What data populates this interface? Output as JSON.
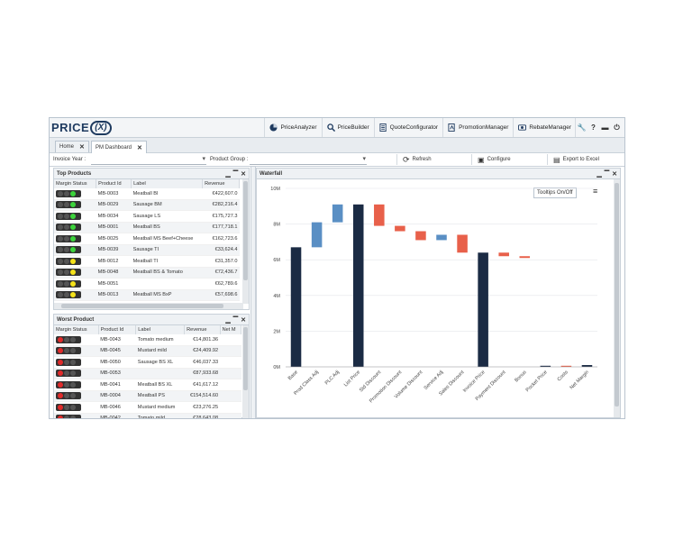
{
  "logo": {
    "text": "PRICE",
    "fx": "(X)"
  },
  "modules": [
    {
      "label": "PriceAnalyzer",
      "icon": "pie-chart-icon",
      "color": "#1e3a5f"
    },
    {
      "label": "PriceBuilder",
      "icon": "search-price-icon",
      "color": "#1e3a5f"
    },
    {
      "label": "QuoteConfigurator",
      "icon": "quote-document-icon",
      "color": "#1e3a5f"
    },
    {
      "label": "PromotionManager",
      "icon": "promotion-document-icon",
      "color": "#1e3a5f"
    },
    {
      "label": "RebateManager",
      "icon": "rebate-icon",
      "color": "#1e3a5f"
    }
  ],
  "tools": [
    "wrench-icon",
    "help-icon",
    "card-icon",
    "logout-icon"
  ],
  "tabs": [
    {
      "label": "Home"
    },
    {
      "label": "PM Dashboard"
    }
  ],
  "filters": {
    "invoice_year": "Invoice Year",
    "product_group": "Product Group",
    "refresh": "Refresh",
    "configure": "Configure",
    "export": "Export to Excel"
  },
  "top_products": {
    "title": "Top Products",
    "columns": [
      "Margin Status",
      "Product Id",
      "Label",
      "Revenue"
    ],
    "rows": [
      {
        "status": "green",
        "id": "MB-0003",
        "label": "Meatball BI",
        "revenue": "€422,607.0"
      },
      {
        "status": "green",
        "id": "MB-0029",
        "label": "Sausage BM",
        "revenue": "€282,216.4"
      },
      {
        "status": "green",
        "id": "MB-0034",
        "label": "Sausage LS",
        "revenue": "€175,727.3"
      },
      {
        "status": "green",
        "id": "MB-0001",
        "label": "Meatball BS",
        "revenue": "€177,718.1"
      },
      {
        "status": "green",
        "id": "MB-0025",
        "label": "Meatball MS Beef+Cheese",
        "revenue": "€162,723.6"
      },
      {
        "status": "green",
        "id": "MB-0039",
        "label": "Sausage TI",
        "revenue": "€33,624.4"
      },
      {
        "status": "yellow",
        "id": "MB-0012",
        "label": "Meatball TI",
        "revenue": "€31,357.0"
      },
      {
        "status": "yellow",
        "id": "MB-0048",
        "label": "Meatball BS & Tomato",
        "revenue": "€72,436.7"
      },
      {
        "status": "yellow",
        "id": "MB-0051",
        "label": "",
        "revenue": "€62,789.6"
      },
      {
        "status": "yellow",
        "id": "MB-0013",
        "label": "Meatball MS BxP",
        "revenue": "€57,698.6"
      },
      {
        "status": "yellow",
        "id": "MB-0021",
        "label": "Sausage BS",
        "revenue": "€178,159.2"
      }
    ]
  },
  "worst_products": {
    "title": "Worst Product",
    "columns": [
      "Margin Status",
      "Product Id",
      "Label",
      "Revenue",
      "Net M"
    ],
    "rows": [
      {
        "status": "red",
        "id": "MB-0043",
        "label": "Tomato medium",
        "revenue": "€14,801.36"
      },
      {
        "status": "red",
        "id": "MB-0045",
        "label": "Mustard mild",
        "revenue": "€24,409.92"
      },
      {
        "status": "red",
        "id": "MB-0050",
        "label": "Sausage BS XL",
        "revenue": "€46,037.33"
      },
      {
        "status": "red",
        "id": "MB-0053",
        "label": "",
        "revenue": "€87,933.68"
      },
      {
        "status": "red",
        "id": "MB-0041",
        "label": "Meatball BS XL",
        "revenue": "€41,617.12"
      },
      {
        "status": "red",
        "id": "MB-0004",
        "label": "Meatball PS",
        "revenue": "€154,514.60"
      },
      {
        "status": "red",
        "id": "MB-0046",
        "label": "Mustard medium",
        "revenue": "€23,276.25"
      },
      {
        "status": "red",
        "id": "MB-0042",
        "label": "Tomato mild",
        "revenue": "€28,643.08"
      }
    ]
  },
  "waterfall": {
    "title": "Waterfall",
    "tooltips_label": "Tooltips On/Off"
  },
  "chart_data": {
    "type": "bar",
    "title": "",
    "ylim": [
      0,
      10
    ],
    "yticks": [
      "0M",
      "2M",
      "4M",
      "6M",
      "8M",
      "10M"
    ],
    "grid": true,
    "categories": [
      "Base",
      "Prod Class Adj",
      "PLC Adj",
      "List Price",
      "Std Discount",
      "Promotion Discount",
      "Volume Discount",
      "Service Adj",
      "Sales Discount",
      "Invoice Price",
      "Payment Discount",
      "Bonus",
      "Pocket Price",
      "Costs",
      "Net Margin"
    ],
    "bars": [
      {
        "start": 0,
        "end": 6.7,
        "kind": "total"
      },
      {
        "start": 6.7,
        "end": 8.1,
        "kind": "increase"
      },
      {
        "start": 8.1,
        "end": 9.1,
        "kind": "increase"
      },
      {
        "start": 0,
        "end": 9.1,
        "kind": "total"
      },
      {
        "start": 9.1,
        "end": 7.9,
        "kind": "decrease"
      },
      {
        "start": 7.9,
        "end": 7.6,
        "kind": "decrease"
      },
      {
        "start": 7.6,
        "end": 7.1,
        "kind": "decrease"
      },
      {
        "start": 7.1,
        "end": 7.4,
        "kind": "increase"
      },
      {
        "start": 7.4,
        "end": 6.4,
        "kind": "decrease"
      },
      {
        "start": 0,
        "end": 6.4,
        "kind": "total"
      },
      {
        "start": 6.4,
        "end": 6.2,
        "kind": "decrease"
      },
      {
        "start": 6.2,
        "end": 6.1,
        "kind": "decrease"
      },
      {
        "start": 0,
        "end": 0.05,
        "kind": "total"
      },
      {
        "start": 0,
        "end": 0,
        "kind": "decrease"
      },
      {
        "start": 0,
        "end": 0.1,
        "kind": "total"
      }
    ],
    "colors": {
      "total": "#1b2b44",
      "increase": "#5a8fc4",
      "decrease": "#e8604a"
    }
  }
}
